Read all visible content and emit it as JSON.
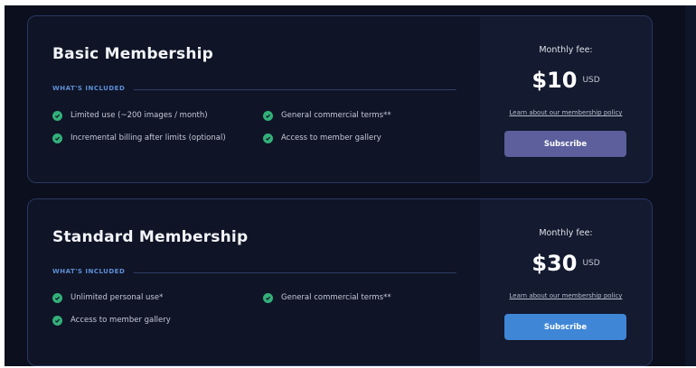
{
  "plans": [
    {
      "title": "Basic Membership",
      "included_label": "WHAT'S INCLUDED",
      "features": [
        "Limited use (~200 images / month)",
        "General commercial terms**",
        "Incremental billing after limits (optional)",
        "Access to member gallery"
      ],
      "fee_label": "Monthly fee:",
      "price": "$10",
      "currency": "USD",
      "policy_link": "Learn about our membership policy",
      "subscribe_label": "Subscribe"
    },
    {
      "title": "Standard Membership",
      "included_label": "WHAT'S INCLUDED",
      "features": [
        "Unlimited personal use*",
        "General commercial terms**",
        "Access to member gallery"
      ],
      "fee_label": "Monthly fee:",
      "price": "$30",
      "currency": "USD",
      "policy_link": "Learn about our membership policy",
      "subscribe_label": "Subscribe"
    }
  ],
  "icons": {
    "feature": "check-circle-icon"
  },
  "colors": {
    "background": "#0b0f1e",
    "card": "#0f1426",
    "check": "#33b07a",
    "accent_label": "#5d8fd6",
    "basic_button": "#5c5f9c",
    "standard_button": "#3f86d6"
  }
}
